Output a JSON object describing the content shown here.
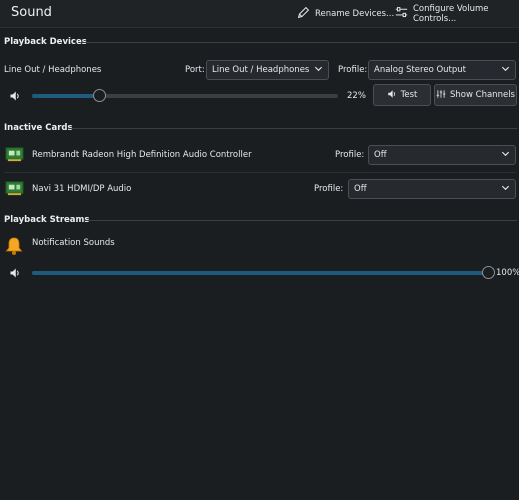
{
  "window": {
    "title": "Sound"
  },
  "toolbar": {
    "rename_label": "Rename Devices...",
    "configure_label": "Configure Volume Controls...",
    "rename_icon": "pencil-icon",
    "configure_icon": "sliders-icon"
  },
  "playback_devices": {
    "section_title": "Playback Devices",
    "device_name": "Line Out / Headphones",
    "port_label": "Port:",
    "port_value": "Line Out / Headphones",
    "profile_label": "Profile:",
    "profile_value": "Analog Stereo Output",
    "volume_percent_text": "22%",
    "volume_level": 0.22,
    "test_label": "Test",
    "show_channels_label": "Show Channels"
  },
  "inactive_cards": {
    "section_title": "Inactive Cards",
    "cards": [
      {
        "name": "Rembrandt Radeon High Definition Audio Controller",
        "profile_label": "Profile:",
        "profile_value": "Off"
      },
      {
        "name": "Navi 31 HDMI/DP Audio",
        "profile_label": "Profile:",
        "profile_value": "Off"
      }
    ]
  },
  "playback_streams": {
    "section_title": "Playback Streams",
    "streams": [
      {
        "name": "Notification Sounds",
        "icon": "bell-icon",
        "volume_percent_text": "100%",
        "volume_level": 1.0
      }
    ]
  },
  "colors": {
    "background": "#1b1e21",
    "accent": "#1f5a7f",
    "bell": "#f5a623"
  }
}
